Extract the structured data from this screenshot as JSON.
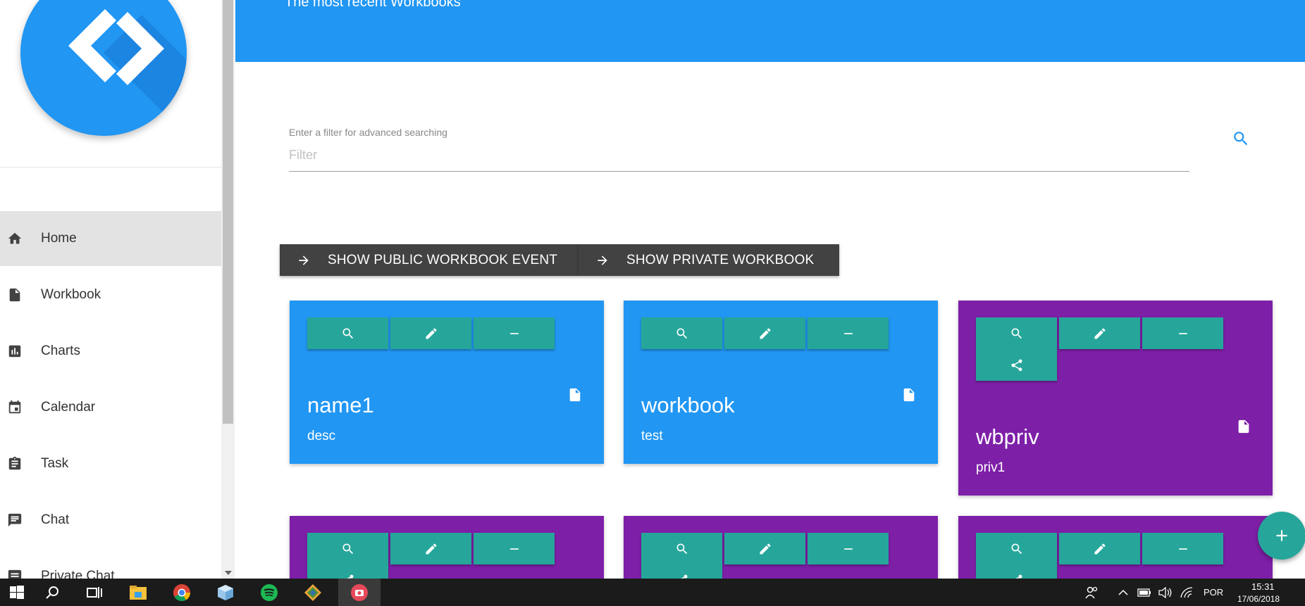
{
  "header": {
    "subtitle": "The most recent Workbooks"
  },
  "sidebar": {
    "items": [
      {
        "label": "Home",
        "icon": "home-icon",
        "active": true
      },
      {
        "label": "Workbook",
        "icon": "file-icon"
      },
      {
        "label": "Charts",
        "icon": "bar-chart-icon"
      },
      {
        "label": "Calendar",
        "icon": "calendar-icon"
      },
      {
        "label": "Task",
        "icon": "clipboard-icon"
      },
      {
        "label": "Chat",
        "icon": "chat-icon"
      },
      {
        "label": "Private Chat",
        "icon": "private-chat-icon"
      }
    ]
  },
  "filter": {
    "label": "Enter a filter for advanced searching",
    "placeholder": "Filter",
    "value": ""
  },
  "toggles": {
    "public_label": "SHOW PUBLIC WORKBOOK EVENT",
    "private_label": "SHOW PRIVATE WORKBOOK"
  },
  "cards": [
    {
      "title": "name1",
      "desc": "desc",
      "color": "#2196f3",
      "kind": "public"
    },
    {
      "title": "workbook",
      "desc": "test",
      "color": "#2196f3",
      "kind": "public"
    },
    {
      "title": "wbpriv",
      "desc": "priv1",
      "color": "#7e1fa8",
      "kind": "private"
    },
    {
      "title": "",
      "desc": "",
      "color": "#7e1fa8",
      "kind": "private"
    },
    {
      "title": "",
      "desc": "",
      "color": "#7e1fa8",
      "kind": "private"
    },
    {
      "title": "",
      "desc": "",
      "color": "#7e1fa8",
      "kind": "private"
    }
  ],
  "fab": {
    "icon": "plus-icon"
  },
  "colors": {
    "primary": "#2196f3",
    "accent": "#26a69a",
    "private_card": "#7e1fa8",
    "dark_button": "#424242"
  },
  "taskbar": {
    "apps": [
      "windows-start-icon",
      "search-icon",
      "task-view-icon",
      "file-explorer-icon",
      "chrome-icon",
      "box-app-icon",
      "spotify-icon",
      "sourcetree-icon",
      "screen-recorder-icon"
    ],
    "tray": {
      "language": "POR",
      "time": "15:31",
      "date": "17/06/2018"
    }
  }
}
